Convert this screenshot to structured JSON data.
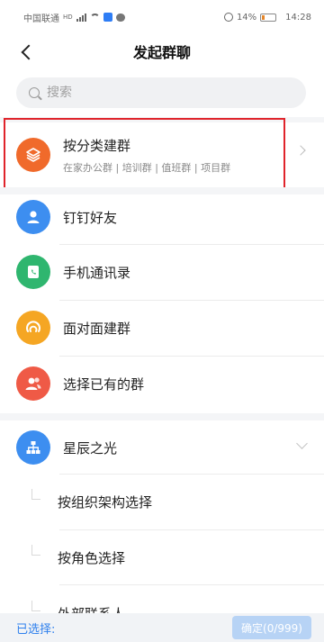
{
  "status_bar": {
    "carrier": "中国联通",
    "carrier_secondary": "HD",
    "battery": "14%",
    "time": "14:28"
  },
  "header": {
    "title": "发起群聊"
  },
  "search": {
    "placeholder": "搜索"
  },
  "category_group": {
    "title": "按分类建群",
    "subtitle": "在家办公群 | 培训群 | 值班群 | 项目群"
  },
  "options": [
    {
      "label": "钉钉好友",
      "icon": "person-icon",
      "color": "#3d8ef0"
    },
    {
      "label": "手机通讯录",
      "icon": "phone-book-icon",
      "color": "#2fb66f"
    },
    {
      "label": "面对面建群",
      "icon": "nearby-icon",
      "color": "#f5a623"
    },
    {
      "label": "选择已有的群",
      "icon": "group-icon",
      "color": "#ef5a46"
    }
  ],
  "organization": {
    "name": "星辰之光",
    "icon": "org-tree-icon",
    "color": "#3d8ef0",
    "sub_items": [
      "按组织架构选择",
      "按角色选择",
      "外部联系人"
    ]
  },
  "footer": {
    "selected_label": "已选择:",
    "confirm_label": "确定(0/999)"
  },
  "colors": {
    "highlight": "#e0242b",
    "accent": "#2f80ed",
    "category_icon": "#f06a2b"
  }
}
